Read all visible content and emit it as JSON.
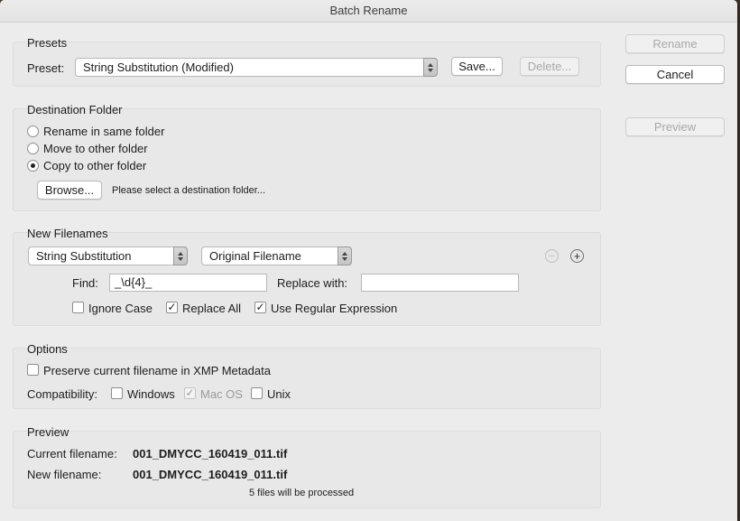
{
  "window": {
    "title": "Batch Rename"
  },
  "side_buttons": {
    "rename": "Rename",
    "cancel": "Cancel",
    "preview": "Preview"
  },
  "presets": {
    "title": "Presets",
    "preset_label": "Preset:",
    "preset_value": "String Substitution (Modified)",
    "save": "Save...",
    "delete": "Delete..."
  },
  "destination": {
    "title": "Destination Folder",
    "options": [
      {
        "label": "Rename in same folder",
        "selected": false
      },
      {
        "label": "Move to other folder",
        "selected": false
      },
      {
        "label": "Copy to other folder",
        "selected": true
      }
    ],
    "browse": "Browse...",
    "folder_hint": "Please select a destination folder..."
  },
  "new_filenames": {
    "title": "New Filenames",
    "type_value": "String Substitution",
    "source_value": "Original Filename",
    "remove_icon": "minus-circle-icon",
    "add_icon": "plus-circle-icon",
    "find_label": "Find:",
    "find_value": "_\\d{4}_",
    "replace_label": "Replace with:",
    "replace_value": "",
    "ignore_case": {
      "label": "Ignore Case",
      "checked": false
    },
    "replace_all": {
      "label": "Replace All",
      "checked": true
    },
    "use_regex": {
      "label": "Use Regular Expression",
      "checked": true
    }
  },
  "options": {
    "title": "Options",
    "preserve": {
      "label": "Preserve current filename in XMP Metadata",
      "checked": false
    },
    "compat_label": "Compatibility:",
    "windows": {
      "label": "Windows",
      "checked": false
    },
    "macos": {
      "label": "Mac OS",
      "checked": true,
      "disabled": true
    },
    "unix": {
      "label": "Unix",
      "checked": false
    }
  },
  "preview": {
    "title": "Preview",
    "current_label": "Current filename:",
    "current_value": "001_DMYCC_160419_011.tif",
    "new_label": "New filename:",
    "new_value": "001_DMYCC_160419_011.tif",
    "count_text": "5 files will be processed"
  }
}
